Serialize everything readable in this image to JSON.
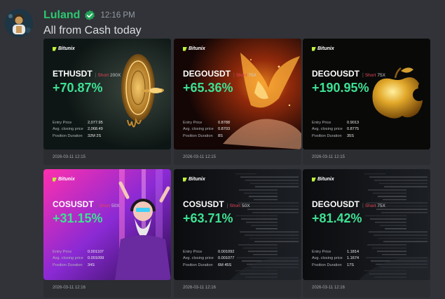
{
  "message": {
    "username": "Luland",
    "timestamp": "12:16 PM",
    "text": "All from Cash today",
    "username_color": "#2dc770"
  },
  "brand": "Bitunix",
  "labels": {
    "entry_price": "Entry Price",
    "avg_closing": "Avg. closing price",
    "duration": "Position Duration"
  },
  "cards": [
    {
      "pair": "ETHUSDT",
      "side": "Short",
      "leverage": "200X",
      "pnl": "+70.87%",
      "entry_price": "2,077.95",
      "avg_closing": "2,068.49",
      "duration": "32M 2S",
      "date": "2026-03-11 12:15",
      "art": "bullet"
    },
    {
      "pair": "DEGOUSDT",
      "side": "Short",
      "leverage": "75X",
      "pnl": "+65.36%",
      "entry_price": "0.8788",
      "avg_closing": "0.8703",
      "duration": "8S",
      "date": "2026-03-11 12:15",
      "art": "phoenix"
    },
    {
      "pair": "DEGOUSDT",
      "side": "Short",
      "leverage": "75X",
      "pnl": "+190.95%",
      "entry_price": "0.9013",
      "avg_closing": "0.8775",
      "duration": "35S",
      "date": "2026-03-11 12:15",
      "art": "apple"
    },
    {
      "pair": "COSUSDT",
      "side": "Short",
      "leverage": "50X",
      "pnl": "+31.15%",
      "entry_price": "0.001107",
      "avg_closing": "0.001099",
      "duration": "34S",
      "date": "2026-03-11 12:16",
      "art": "dj"
    },
    {
      "pair": "COSUSDT",
      "side": "Short",
      "leverage": "50X",
      "pnl": "+63.71%",
      "entry_price": "0.001092",
      "avg_closing": "0.001077",
      "duration": "6M 45S",
      "date": "2026-03-11 12:16",
      "art": "code"
    },
    {
      "pair": "DEGOUSDT",
      "side": "Short",
      "leverage": "75X",
      "pnl": "+81.42%",
      "entry_price": "1.1814",
      "avg_closing": "1.1674",
      "duration": "17S",
      "date": "2026-03-11 12:16",
      "art": "code"
    }
  ]
}
